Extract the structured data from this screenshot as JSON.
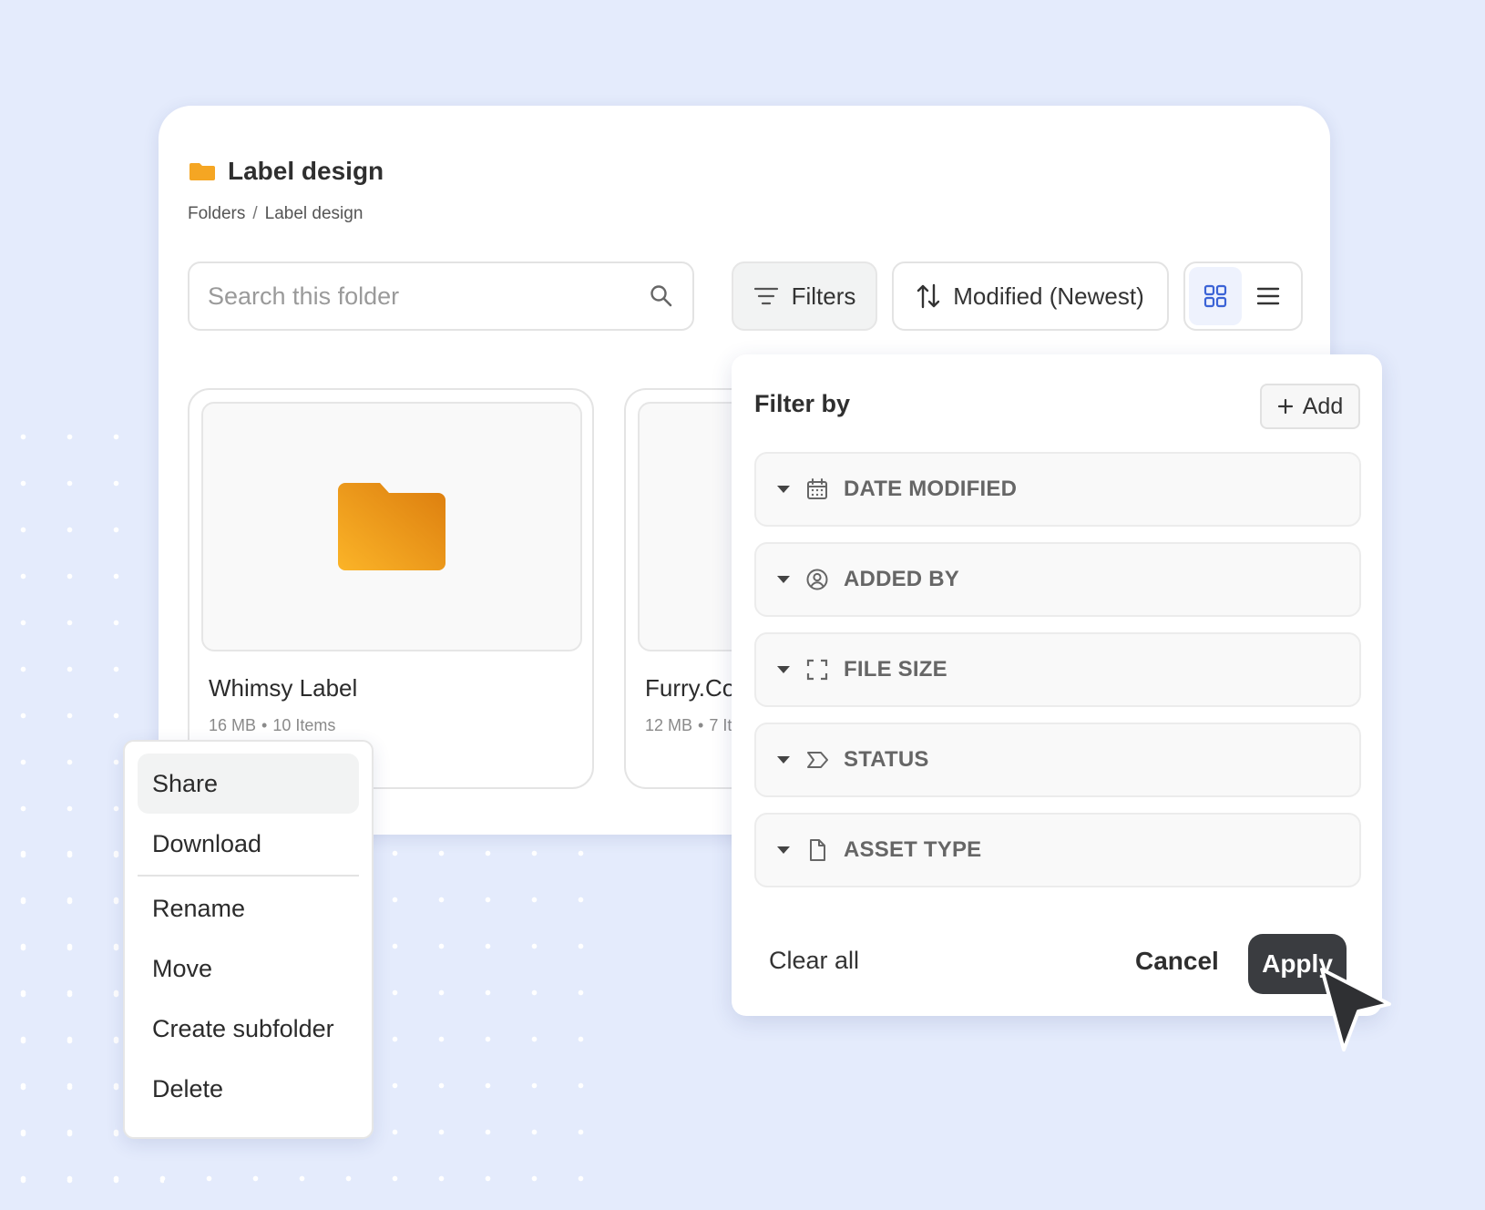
{
  "header": {
    "title": "Label design",
    "breadcrumb": [
      "Folders",
      "Label design"
    ],
    "breadcrumb_separator": "/"
  },
  "toolbar": {
    "search_placeholder": "Search this folder",
    "filters_label": "Filters",
    "sort_label": "Modified (Newest)",
    "view_mode": "grid"
  },
  "cards": [
    {
      "name": "Whimsy Label",
      "size": "16 MB",
      "items": "10 Items"
    },
    {
      "name": "Furry.Co",
      "size": "12 MB",
      "items": "7 It"
    }
  ],
  "context_menu": {
    "items": [
      "Share",
      "Download",
      "Rename",
      "Move",
      "Create subfolder",
      "Delete"
    ]
  },
  "filter_panel": {
    "title": "Filter by",
    "add_label": "Add",
    "filters": [
      {
        "label": "DATE MODIFIED",
        "icon": "calendar-icon"
      },
      {
        "label": "ADDED BY",
        "icon": "user-circle-icon"
      },
      {
        "label": "FILE SIZE",
        "icon": "expand-icon"
      },
      {
        "label": "STATUS",
        "icon": "tag-icon"
      },
      {
        "label": "ASSET TYPE",
        "icon": "document-icon"
      }
    ],
    "clear_label": "Clear all",
    "cancel_label": "Cancel",
    "apply_label": "Apply"
  },
  "colors": {
    "background": "#e4ebfc",
    "folder": "#f5a623",
    "accent": "#3b63d6",
    "apply_button": "#3a3c40"
  }
}
